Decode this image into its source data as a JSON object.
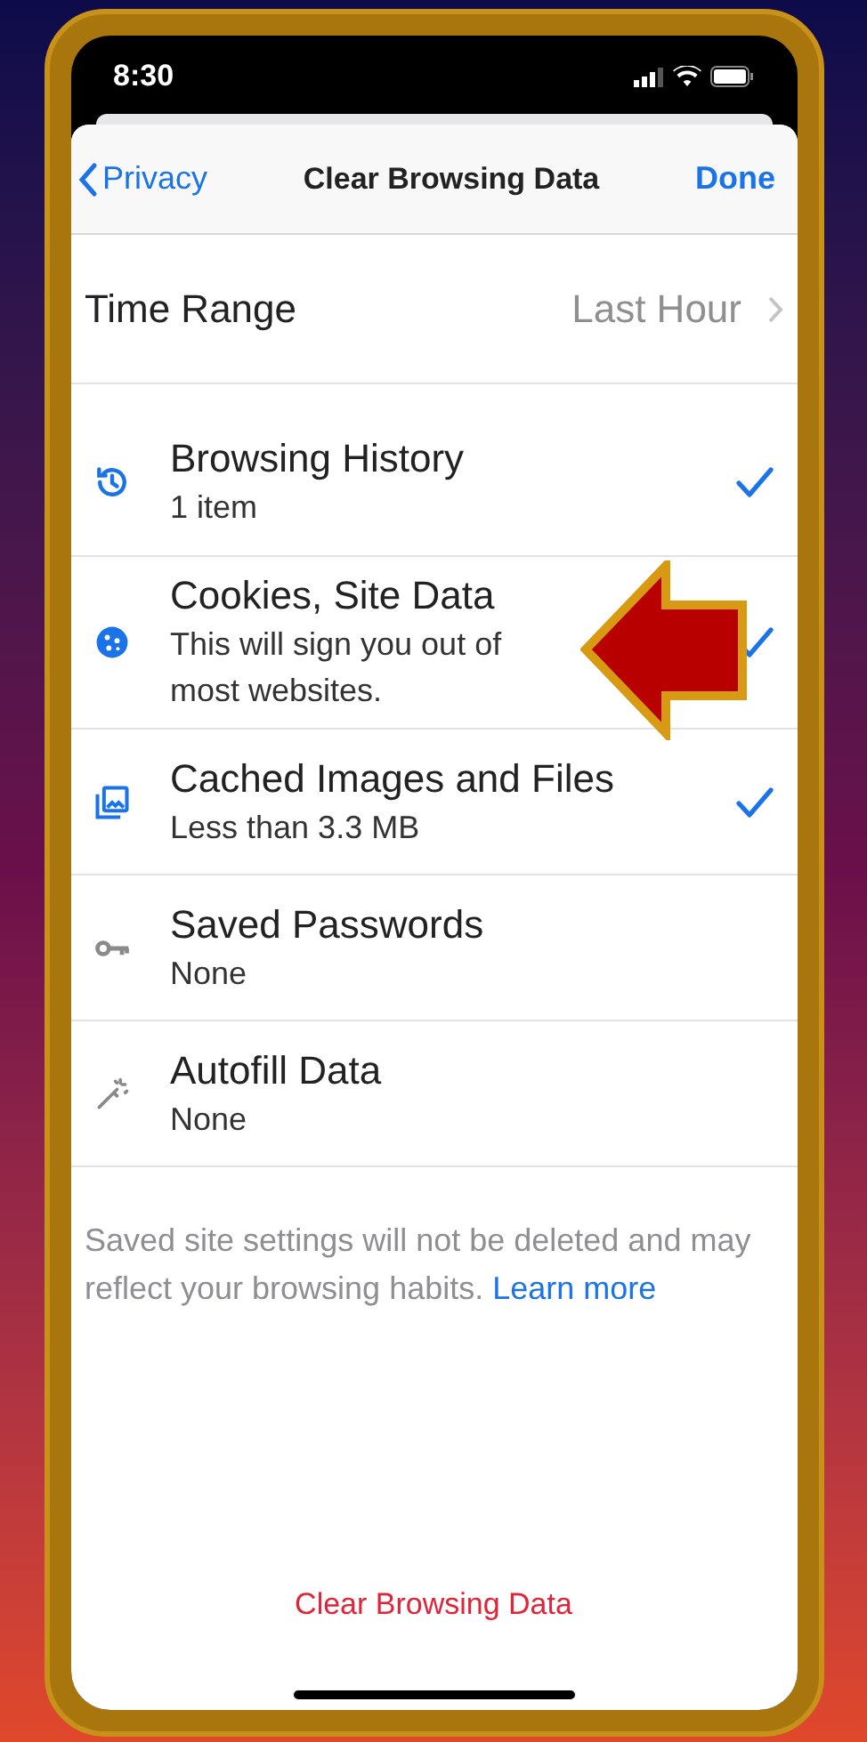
{
  "status_bar": {
    "time": "8:30"
  },
  "nav": {
    "back": "Privacy",
    "title": "Clear Browsing Data",
    "done": "Done"
  },
  "time_range": {
    "label": "Time Range",
    "value": "Last Hour"
  },
  "items": [
    {
      "kind": "history",
      "title": "Browsing History",
      "subtitle": "1 item",
      "checked": true
    },
    {
      "kind": "cookies",
      "title": "Cookies, Site Data",
      "subtitle": "This will sign you out of most websites.",
      "checked": true
    },
    {
      "kind": "cache",
      "title": "Cached Images and Files",
      "subtitle": "Less than 3.3 MB",
      "checked": true
    },
    {
      "kind": "passwords",
      "title": "Saved Passwords",
      "subtitle": "None",
      "checked": false
    },
    {
      "kind": "autofill",
      "title": "Autofill Data",
      "subtitle": "None",
      "checked": false
    }
  ],
  "footer": {
    "note": "Saved site settings will not be deleted and may reflect your browsing habits.",
    "link": "Learn more"
  },
  "action": "Clear Browsing Data"
}
